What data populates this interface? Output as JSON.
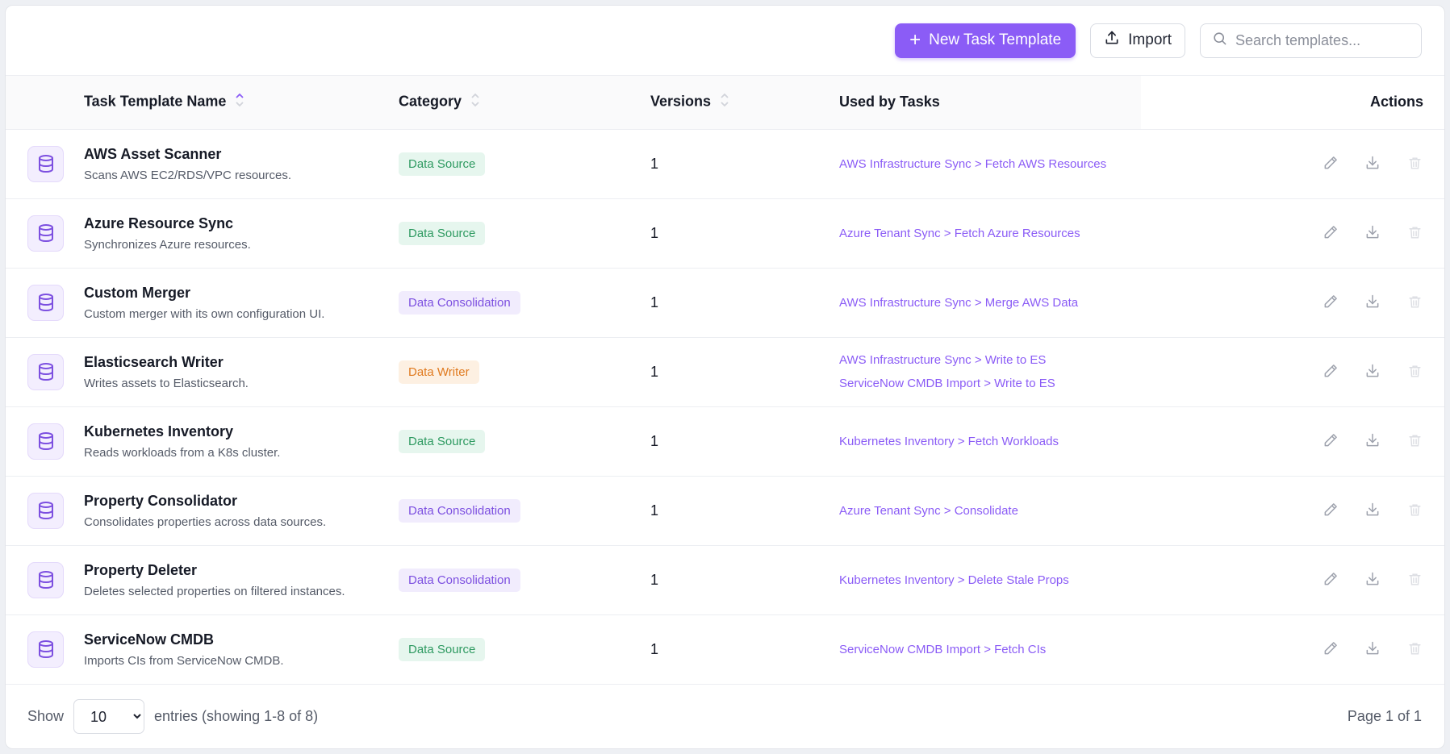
{
  "toolbar": {
    "new_label": "New Task Template",
    "import_label": "Import",
    "search_placeholder": "Search templates..."
  },
  "columns": {
    "name": "Task Template Name",
    "category": "Category",
    "versions": "Versions",
    "used_by": "Used by Tasks",
    "actions": "Actions"
  },
  "rows": [
    {
      "name": "AWS Asset Scanner",
      "desc": "Scans AWS EC2/RDS/VPC resources.",
      "category": "Data Source",
      "cat_class": "source",
      "version": "1",
      "used": [
        "AWS Infrastructure Sync > Fetch AWS Resources"
      ]
    },
    {
      "name": "Azure Resource Sync",
      "desc": "Synchronizes Azure resources.",
      "category": "Data Source",
      "cat_class": "source",
      "version": "1",
      "used": [
        "Azure Tenant Sync > Fetch Azure Resources"
      ]
    },
    {
      "name": "Custom Merger",
      "desc": "Custom merger with its own configuration UI.",
      "category": "Data Consolidation",
      "cat_class": "consolidation",
      "version": "1",
      "used": [
        "AWS Infrastructure Sync > Merge AWS Data"
      ]
    },
    {
      "name": "Elasticsearch Writer",
      "desc": "Writes assets to Elasticsearch.",
      "category": "Data Writer",
      "cat_class": "writer",
      "version": "1",
      "used": [
        "AWS Infrastructure Sync > Write to ES",
        "ServiceNow CMDB Import > Write to ES"
      ]
    },
    {
      "name": "Kubernetes Inventory",
      "desc": "Reads workloads from a K8s cluster.",
      "category": "Data Source",
      "cat_class": "source",
      "version": "1",
      "used": [
        "Kubernetes Inventory > Fetch Workloads"
      ]
    },
    {
      "name": "Property Consolidator",
      "desc": "Consolidates properties across data sources.",
      "category": "Data Consolidation",
      "cat_class": "consolidation",
      "version": "1",
      "used": [
        "Azure Tenant Sync > Consolidate"
      ]
    },
    {
      "name": "Property Deleter",
      "desc": "Deletes selected properties on filtered instances.",
      "category": "Data Consolidation",
      "cat_class": "consolidation",
      "version": "1",
      "used": [
        "Kubernetes Inventory > Delete Stale Props"
      ]
    },
    {
      "name": "ServiceNow CMDB",
      "desc": "Imports CIs from ServiceNow CMDB.",
      "category": "Data Source",
      "cat_class": "source",
      "version": "1",
      "used": [
        "ServiceNow CMDB Import > Fetch CIs"
      ]
    }
  ],
  "footer": {
    "show_label": "Show",
    "page_size": "10",
    "page_size_options": [
      "10"
    ],
    "entries_label": "entries (showing 1-8 of 8)",
    "page_label": "Page 1 of 1"
  },
  "colors": {
    "accent": "#8b5cf6",
    "source_bg": "#e6f6ee",
    "source_fg": "#2e9a61",
    "consolidation_bg": "#f1ecfd",
    "consolidation_fg": "#7c4fe0",
    "writer_bg": "#fdf0e2",
    "writer_fg": "#e07a1f"
  },
  "icons": {
    "row": "database-icon",
    "actions": [
      "edit-icon",
      "download-icon",
      "trash-icon"
    ],
    "search": "search-icon",
    "import": "upload-icon"
  }
}
